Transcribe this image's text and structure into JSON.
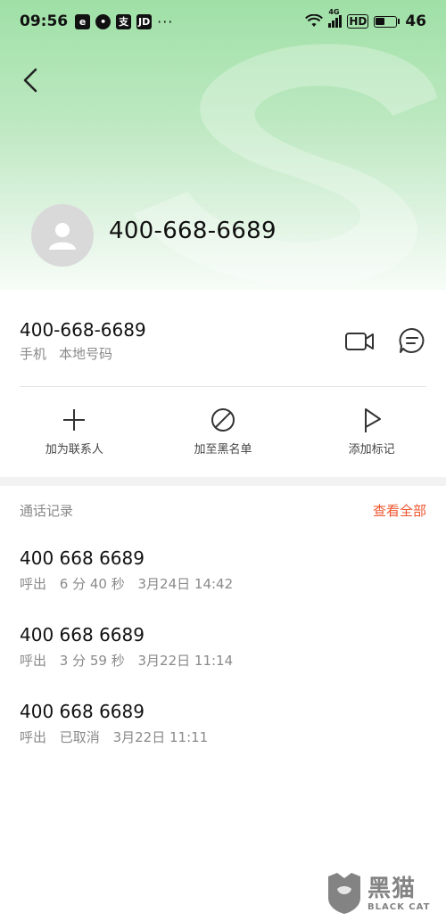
{
  "status_bar": {
    "time": "09:56",
    "left_icons": [
      "e",
      "wechat",
      "alipay",
      "JD"
    ],
    "dots": "···",
    "network": "4G",
    "hd": "HD",
    "battery": "46"
  },
  "header": {
    "contact_name": "400-668-6689"
  },
  "number": {
    "value": "400-668-6689",
    "type": "手机",
    "location": "本地号码"
  },
  "actions": [
    {
      "label": "加为联系人",
      "icon": "plus-icon"
    },
    {
      "label": "加至黑名单",
      "icon": "block-icon"
    },
    {
      "label": "添加标记",
      "icon": "flag-icon"
    }
  ],
  "call_log": {
    "title": "通话记录",
    "view_all": "查看全部",
    "accent": "#f0542d",
    "items": [
      {
        "number": "400 668 6689",
        "direction": "呼出",
        "duration": "6 分 40 秒",
        "time": "3月24日 14:42"
      },
      {
        "number": "400 668 6689",
        "direction": "呼出",
        "duration": "3 分 59 秒",
        "time": "3月22日 11:14"
      },
      {
        "number": "400 668 6689",
        "direction": "呼出",
        "duration": "已取消",
        "time": "3月22日 11:11"
      }
    ]
  },
  "watermark": {
    "cn": "黑猫",
    "en": "BLACK CAT"
  }
}
